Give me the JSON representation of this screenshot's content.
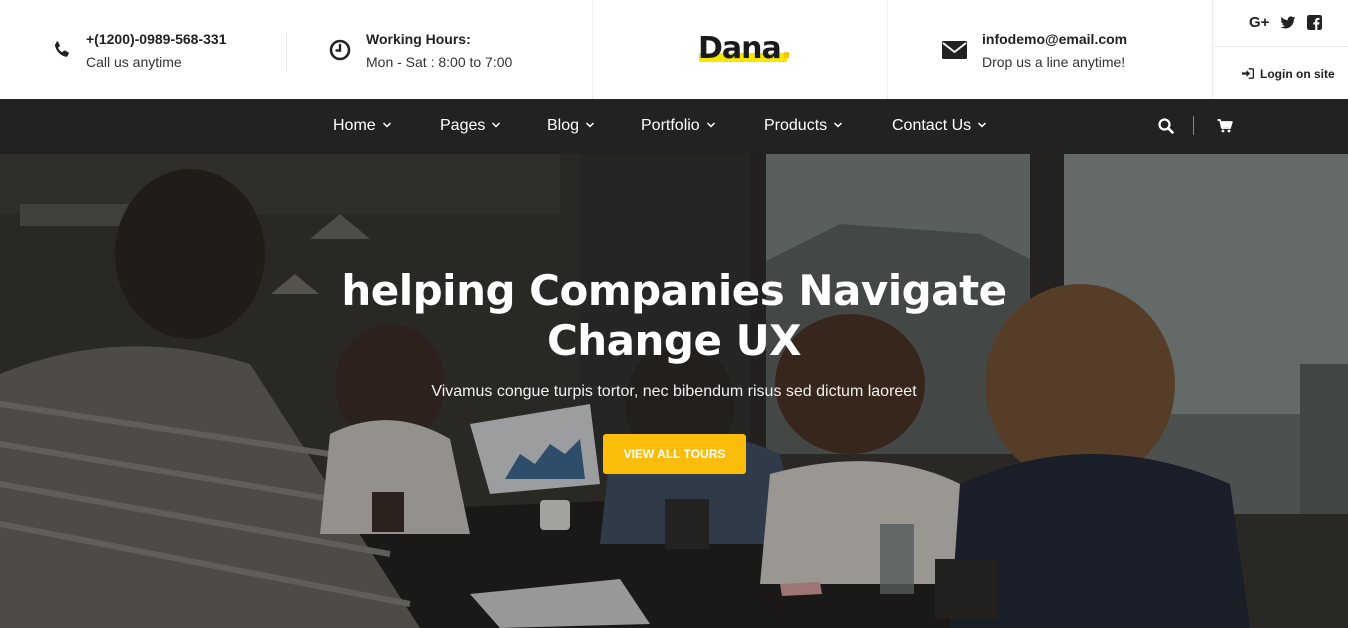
{
  "contact": {
    "phone": "+(1200)-0989-568-331",
    "phone_sub": "Call us anytime",
    "hours_title": "Working Hours:",
    "hours_value": "Mon - Sat : 8:00 to 7:00",
    "email": "infodemo@email.com",
    "email_sub": "Drop us a line anytime!"
  },
  "logo": {
    "text": "Dana",
    "dot": "."
  },
  "social": {
    "google": "G+",
    "twitter": "twitter-icon",
    "facebook": "facebook-icon"
  },
  "login_label": "Login on site",
  "nav": {
    "items": [
      {
        "label": "Home"
      },
      {
        "label": "Pages"
      },
      {
        "label": "Blog"
      },
      {
        "label": "Portfolio"
      },
      {
        "label": "Products"
      },
      {
        "label": "Contact Us"
      }
    ]
  },
  "hero": {
    "title_line1": "helping Companies Navigate",
    "title_line2": "Change UX",
    "subtitle": "Vivamus congue turpis tortor, nec bibendum risus sed dictum laoreet",
    "button": "VIEW ALL TOURS"
  },
  "colors": {
    "accent": "#fbbd0b",
    "nav_bg": "#222222",
    "logo_highlight": "#f6e600"
  }
}
